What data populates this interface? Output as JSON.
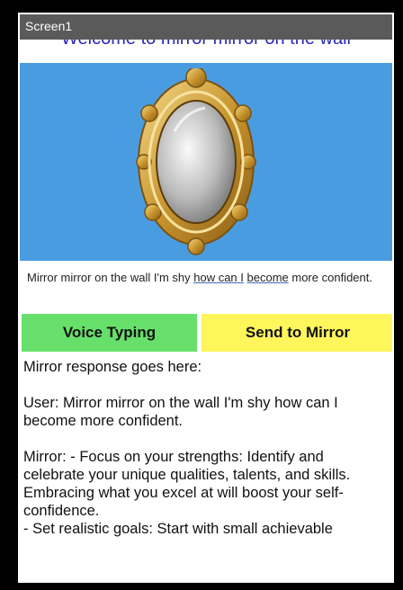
{
  "screen": {
    "title": "Screen1",
    "welcome_text": "Welcome to mirror mirror on the wall"
  },
  "prompt": {
    "parts": [
      "Mirror mirror on the wall I'm shy ",
      "how can I",
      " ",
      "become",
      " more confident."
    ]
  },
  "buttons": {
    "voice_typing": "Voice Typing",
    "send_to_mirror": "Send to Mirror"
  },
  "response": {
    "header": "Mirror response goes here:",
    "user_line": "User: Mirror mirror on the wall I'm shy how can I become more confident.",
    "mirror_line": "Mirror: - Focus on your strengths: Identify and celebrate your unique qualities, talents, and skills. Embracing what you excel at will boost your self-confidence.",
    "tip_line": "- Set realistic goals: Start with small achievable"
  },
  "colors": {
    "hero_bg": "#4a9ce0",
    "voice_button": "#66e06a",
    "send_button": "#fff65c",
    "welcome_text": "#2a2ab8"
  }
}
